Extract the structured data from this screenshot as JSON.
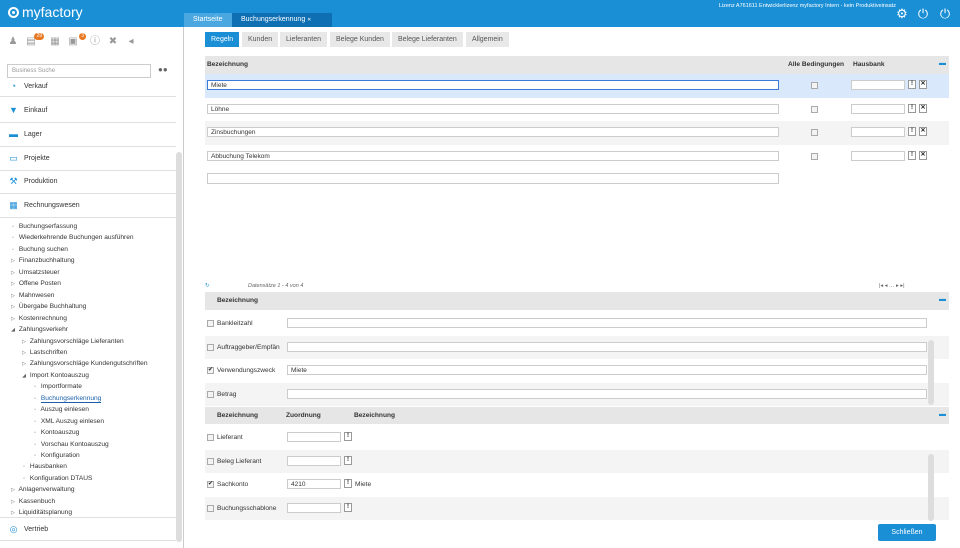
{
  "app": {
    "logo": "myfactory",
    "license": "Lizenz A761611 Entwicklerlizenz myfactory Intern - kein Produktiveinsatz"
  },
  "tabs": [
    {
      "label": "Startseite"
    },
    {
      "label": "Buchungserkennung"
    }
  ],
  "tab_close": "✕",
  "sidebar": {
    "badges": {
      "b1": "29",
      "b2": "3"
    },
    "search_placeholder": "Business Suche",
    "modules": [
      {
        "label": "Verkauf",
        "icon": "sales-icon"
      },
      {
        "label": "Einkauf",
        "icon": "cart-icon"
      },
      {
        "label": "Lager",
        "icon": "warehouse-icon"
      },
      {
        "label": "Projekte",
        "icon": "projects-icon"
      },
      {
        "label": "Produktion",
        "icon": "production-icon"
      },
      {
        "label": "Rechnungswesen",
        "icon": "accounting-icon"
      }
    ],
    "tree": [
      {
        "label": "Buchungserfassung",
        "icon": "page"
      },
      {
        "label": "Wiederkehrende Buchungen ausführen",
        "icon": "page"
      },
      {
        "label": "Buchung suchen",
        "icon": "page"
      },
      {
        "label": "Finanzbuchhaltung",
        "icon": "closed"
      },
      {
        "label": "Umsatzsteuer",
        "icon": "closed"
      },
      {
        "label": "Offene Posten",
        "icon": "closed"
      },
      {
        "label": "Mahnwesen",
        "icon": "closed"
      },
      {
        "label": "Übergabe Buchhaltung",
        "icon": "closed"
      },
      {
        "label": "Kostenrechnung",
        "icon": "closed"
      },
      {
        "label": "Zahlungsverkehr",
        "icon": "open"
      },
      {
        "label": "Zahlungsvorschläge Lieferanten",
        "icon": "closed"
      },
      {
        "label": "Lastschriften",
        "icon": "closed"
      },
      {
        "label": "Zahlungsvorschläge Kundengutschriften",
        "icon": "closed"
      },
      {
        "label": "Import Kontoauszug",
        "icon": "open"
      },
      {
        "label": "Importformate",
        "icon": "page"
      },
      {
        "label": "Buchungserkennung",
        "icon": "page"
      },
      {
        "label": "Auszug einlesen",
        "icon": "page"
      },
      {
        "label": "XML Auszug einlesen",
        "icon": "page"
      },
      {
        "label": "Kontoauszug",
        "icon": "page"
      },
      {
        "label": "Vorschau Kontoauszug",
        "icon": "page"
      },
      {
        "label": "Konfiguration",
        "icon": "page"
      },
      {
        "label": "Hausbanken",
        "icon": "page"
      },
      {
        "label": "Konfiguration DTAUS",
        "icon": "page"
      },
      {
        "label": "Anlagenverwaltung",
        "icon": "closed"
      },
      {
        "label": "Kassenbuch",
        "icon": "closed"
      },
      {
        "label": "Liquiditätsplanung",
        "icon": "closed"
      }
    ],
    "bottom_module": {
      "label": "Vertrieb",
      "icon": "distribution-icon"
    }
  },
  "subtabs": [
    {
      "label": "Regeln"
    },
    {
      "label": "Kunden"
    },
    {
      "label": "Lieferanten"
    },
    {
      "label": "Belege Kunden"
    },
    {
      "label": "Belege Lieferanten"
    },
    {
      "label": "Allgemein"
    }
  ],
  "rules_grid": {
    "headers": {
      "name": "Bezeichnung",
      "all": "Alle Bedingungen",
      "bank": "Hausbank"
    },
    "rows": [
      {
        "name": "Miete"
      },
      {
        "name": "Löhne"
      },
      {
        "name": "Zinsbuchungen"
      },
      {
        "name": "Abbuchung Telekom"
      }
    ],
    "pager": "Datensätze 1 - 4 von 4",
    "row_btn": "!",
    "row_del": "✕"
  },
  "conditions": {
    "header": "Bezeichnung",
    "rows": [
      {
        "label": "Bankleitzahl",
        "checked": false,
        "value": ""
      },
      {
        "label": "Auftraggeber/Empfän",
        "checked": false,
        "value": ""
      },
      {
        "label": "Verwendungszweck",
        "checked": true,
        "value": "Miete"
      },
      {
        "label": "Betrag",
        "checked": false,
        "value": ""
      }
    ]
  },
  "assignment": {
    "headers": {
      "name": "Bezeichnung",
      "assign": "Zuordnung",
      "desc": "Bezeichnung"
    },
    "rows": [
      {
        "label": "Lieferant",
        "checked": false,
        "value": "",
        "desc": ""
      },
      {
        "label": "Beleg Lieferant",
        "checked": false,
        "value": "",
        "desc": ""
      },
      {
        "label": "Sachkonto",
        "checked": true,
        "value": "4210",
        "desc": "Miete"
      },
      {
        "label": "Buchungsschablone",
        "checked": false,
        "value": "",
        "desc": ""
      }
    ]
  },
  "close_button": "Schließen",
  "check_mark": "✔"
}
